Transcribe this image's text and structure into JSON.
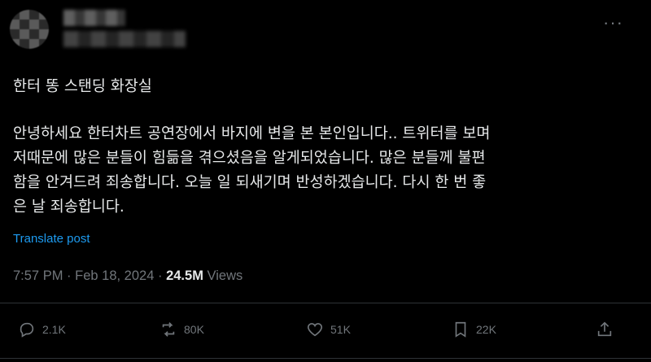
{
  "tweet": {
    "title": "한터 똥 스탠딩 화장실",
    "body_lines": [
      "안녕하세요 한터차트 공연장에서 바지에 변을 본 본인입니다.. 트위터를 보며",
      "저때문에 많은 분들이 힘듦을 겪으셨음을 알게되었습니다. 많은 분들께 불편",
      "함을 안겨드려 죄송합니다. 오늘 일 되새기며 반성하겠습니다. 다시 한 번 좋",
      "은 날 죄송합니다."
    ],
    "translate_label": "Translate post"
  },
  "meta": {
    "time": "7:57 PM",
    "sep1": "·",
    "date": "Feb 18, 2024",
    "sep2": "·",
    "views_count": "24.5M",
    "views_label": "Views"
  },
  "actions": {
    "replies": "2.1K",
    "reposts": "80K",
    "likes": "51K",
    "bookmarks": "22K"
  },
  "more_label": "···"
}
